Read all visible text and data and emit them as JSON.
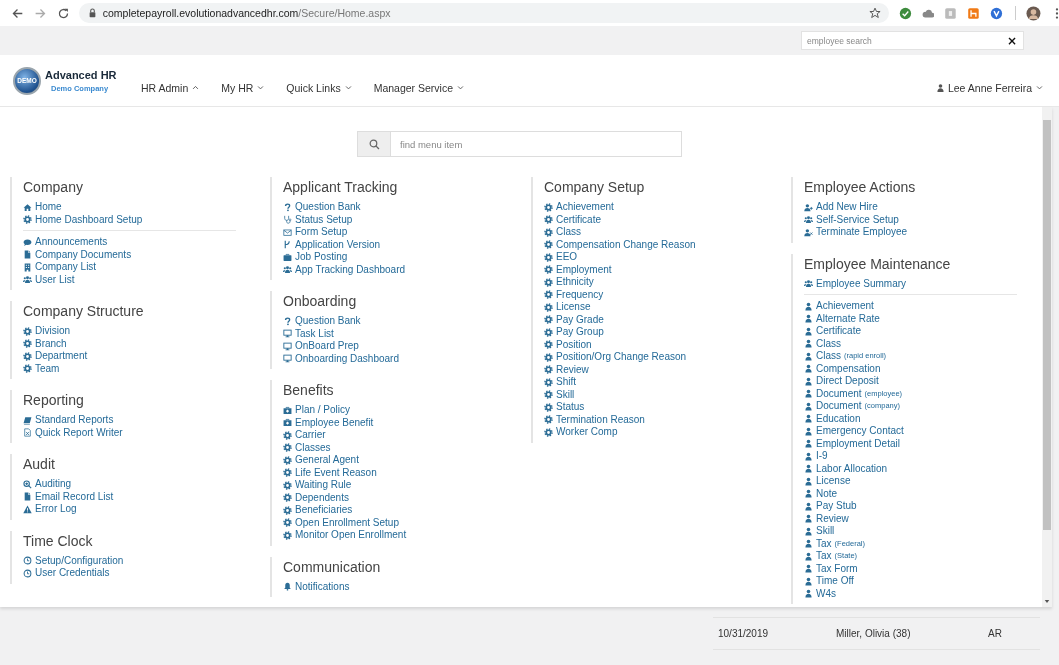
{
  "browser": {
    "url_host": "completepayroll.evolutionadvancedhr.com",
    "url_path": "/Secure/Home.aspx"
  },
  "top_bar": {
    "search": {
      "placeholder": "employee search"
    },
    "clear": "×"
  },
  "header": {
    "logo": {
      "badge": "DEMO",
      "title": "Advanced HR",
      "subtitle": "Demo Company"
    },
    "nav": [
      {
        "label": "HR Admin",
        "expanded": true
      },
      {
        "label": "My HR",
        "expanded": false
      },
      {
        "label": "Quick Links",
        "expanded": false
      },
      {
        "label": "Manager Service",
        "expanded": false
      }
    ],
    "user": "Lee Anne Ferreira"
  },
  "menu": {
    "search": {
      "placeholder": "find menu item"
    },
    "columns": [
      [
        {
          "title": "Company",
          "blocks": [
            [
              {
                "label": "Home",
                "kind": "home"
              },
              {
                "label": "Home Dashboard Setup",
                "kind": "gear"
              }
            ],
            [
              {
                "label": "Announcements",
                "kind": "comment"
              },
              {
                "label": "Company Documents",
                "kind": "file"
              },
              {
                "label": "Company List",
                "kind": "building"
              },
              {
                "label": "User List",
                "kind": "users"
              }
            ]
          ]
        },
        {
          "title": "Company Structure",
          "blocks": [
            [
              {
                "label": "Division",
                "kind": "gear"
              },
              {
                "label": "Branch",
                "kind": "gear"
              },
              {
                "label": "Department",
                "kind": "gear"
              },
              {
                "label": "Team",
                "kind": "gear"
              }
            ]
          ]
        },
        {
          "title": "Reporting",
          "blocks": [
            [
              {
                "label": "Standard Reports",
                "kind": "book"
              },
              {
                "label": "Quick Report Writer",
                "kind": "sheet"
              }
            ]
          ]
        },
        {
          "title": "Audit",
          "blocks": [
            [
              {
                "label": "Auditing",
                "kind": "zoom"
              },
              {
                "label": "Email Record List",
                "kind": "file"
              },
              {
                "label": "Error Log",
                "kind": "warning"
              }
            ]
          ]
        },
        {
          "title": "Time Clock",
          "blocks": [
            [
              {
                "label": "Setup/Configuration",
                "kind": "clock"
              },
              {
                "label": "User Credentials",
                "kind": "clock"
              }
            ]
          ]
        }
      ],
      [
        {
          "title": "Applicant Tracking",
          "blocks": [
            [
              {
                "label": "Question Bank",
                "kind": "question"
              },
              {
                "label": "Status Setup",
                "kind": "stethoscope"
              },
              {
                "label": "Form Setup",
                "kind": "envelope"
              },
              {
                "label": "Application Version",
                "kind": "branch"
              },
              {
                "label": "Job Posting",
                "kind": "briefcase"
              },
              {
                "label": "App Tracking Dashboard",
                "kind": "users"
              }
            ]
          ]
        },
        {
          "title": "Onboarding",
          "blocks": [
            [
              {
                "label": "Question Bank",
                "kind": "question"
              },
              {
                "label": "Task List",
                "kind": "desktop"
              },
              {
                "label": "OnBoard Prep",
                "kind": "desktop"
              },
              {
                "label": "Onboarding Dashboard",
                "kind": "desktop"
              }
            ]
          ]
        },
        {
          "title": "Benefits",
          "blocks": [
            [
              {
                "label": "Plan / Policy",
                "kind": "medkit"
              },
              {
                "label": "Employee Benefit",
                "kind": "medkit"
              },
              {
                "label": "Carrier",
                "kind": "gear"
              },
              {
                "label": "Classes",
                "kind": "gear"
              },
              {
                "label": "General Agent",
                "kind": "gear"
              },
              {
                "label": "Life Event Reason",
                "kind": "gear"
              },
              {
                "label": "Waiting Rule",
                "kind": "gear"
              },
              {
                "label": "Dependents",
                "kind": "gear"
              },
              {
                "label": "Beneficiaries",
                "kind": "gear"
              },
              {
                "label": "Open Enrollment Setup",
                "kind": "gear"
              },
              {
                "label": "Monitor Open Enrollment",
                "kind": "gear"
              }
            ]
          ]
        },
        {
          "title": "Communication",
          "blocks": [
            [
              {
                "label": "Notifications",
                "kind": "bell"
              }
            ]
          ]
        }
      ],
      [
        {
          "title": "Company Setup",
          "blocks": [
            [
              {
                "label": "Achievement",
                "kind": "gear"
              },
              {
                "label": "Certificate",
                "kind": "gear"
              },
              {
                "label": "Class",
                "kind": "gear"
              },
              {
                "label": "Compensation Change Reason",
                "kind": "gear"
              },
              {
                "label": "EEO",
                "kind": "gear"
              },
              {
                "label": "Employment",
                "kind": "gear"
              },
              {
                "label": "Ethnicity",
                "kind": "gear"
              },
              {
                "label": "Frequency",
                "kind": "gear"
              },
              {
                "label": "License",
                "kind": "gear"
              },
              {
                "label": "Pay Grade",
                "kind": "gear"
              },
              {
                "label": "Pay Group",
                "kind": "gear"
              },
              {
                "label": "Position",
                "kind": "gear"
              },
              {
                "label": "Position/Org Change Reason",
                "kind": "gear"
              },
              {
                "label": "Review",
                "kind": "gear"
              },
              {
                "label": "Shift",
                "kind": "gear"
              },
              {
                "label": "Skill",
                "kind": "gear"
              },
              {
                "label": "Status",
                "kind": "gear"
              },
              {
                "label": "Termination Reason",
                "kind": "gear"
              },
              {
                "label": "Worker Comp",
                "kind": "gear"
              }
            ]
          ]
        }
      ],
      [
        {
          "title": "Employee Actions",
          "blocks": [
            [
              {
                "label": "Add New Hire",
                "kind": "user-plus"
              },
              {
                "label": "Self-Service Setup",
                "kind": "users"
              },
              {
                "label": "Terminate Employee",
                "kind": "user-times"
              }
            ]
          ]
        },
        {
          "title": "Employee Maintenance",
          "blocks": [
            [
              {
                "label": "Employee Summary",
                "kind": "users"
              }
            ],
            [
              {
                "label": "Achievement",
                "kind": "user"
              },
              {
                "label": "Alternate Rate",
                "kind": "user"
              },
              {
                "label": "Certificate",
                "kind": "user"
              },
              {
                "label": "Class",
                "kind": "user"
              },
              {
                "label": "Class",
                "note": "(rapid enroll)",
                "kind": "user"
              },
              {
                "label": "Compensation",
                "kind": "user"
              },
              {
                "label": "Direct Deposit",
                "kind": "user"
              },
              {
                "label": "Document",
                "note": "(employee)",
                "kind": "user"
              },
              {
                "label": "Document",
                "note": "(company)",
                "kind": "user"
              },
              {
                "label": "Education",
                "kind": "user"
              },
              {
                "label": "Emergency Contact",
                "kind": "user"
              },
              {
                "label": "Employment Detail",
                "kind": "user"
              },
              {
                "label": "I-9",
                "kind": "user"
              },
              {
                "label": "Labor Allocation",
                "kind": "user"
              },
              {
                "label": "License",
                "kind": "user"
              },
              {
                "label": "Note",
                "kind": "user"
              },
              {
                "label": "Pay Stub",
                "kind": "user"
              },
              {
                "label": "Review",
                "kind": "user"
              },
              {
                "label": "Skill",
                "kind": "user"
              },
              {
                "label": "Tax",
                "note": "(Federal)",
                "kind": "user"
              },
              {
                "label": "Tax",
                "note": "(State)",
                "kind": "user"
              },
              {
                "label": "Tax Form",
                "kind": "user"
              },
              {
                "label": "Time Off",
                "kind": "user"
              },
              {
                "label": "W4s",
                "kind": "user"
              }
            ]
          ]
        }
      ]
    ]
  },
  "table": {
    "rows": [
      [
        "10/31/2019",
        "Miller, Olivia (38)",
        "AR"
      ]
    ]
  }
}
